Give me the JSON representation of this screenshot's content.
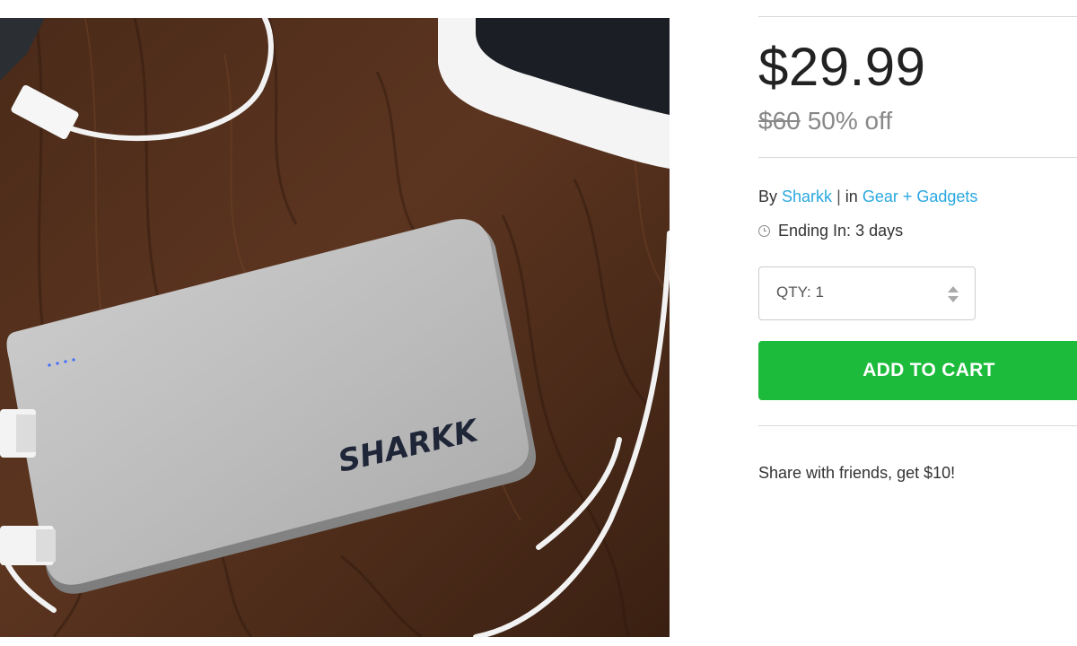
{
  "product": {
    "image_alt": "Sharkk power bank on wooden table with tablet and cables",
    "brand_logo_text": "SHARKK"
  },
  "pricing": {
    "price": "$29.99",
    "original_price": "$60",
    "discount": "50% off"
  },
  "meta": {
    "by_prefix": "By",
    "vendor": "Sharkk",
    "separator": "|",
    "in_prefix": "in",
    "category": "Gear + Gadgets",
    "ending_label": "Ending In: 3 days"
  },
  "quantity": {
    "label": "QTY: 1"
  },
  "actions": {
    "add_to_cart": "ADD TO CART"
  },
  "share": {
    "text": "Share with friends, get $10!"
  },
  "colors": {
    "accent_green": "#1dbb3b",
    "link_blue": "#2aa8e0"
  }
}
